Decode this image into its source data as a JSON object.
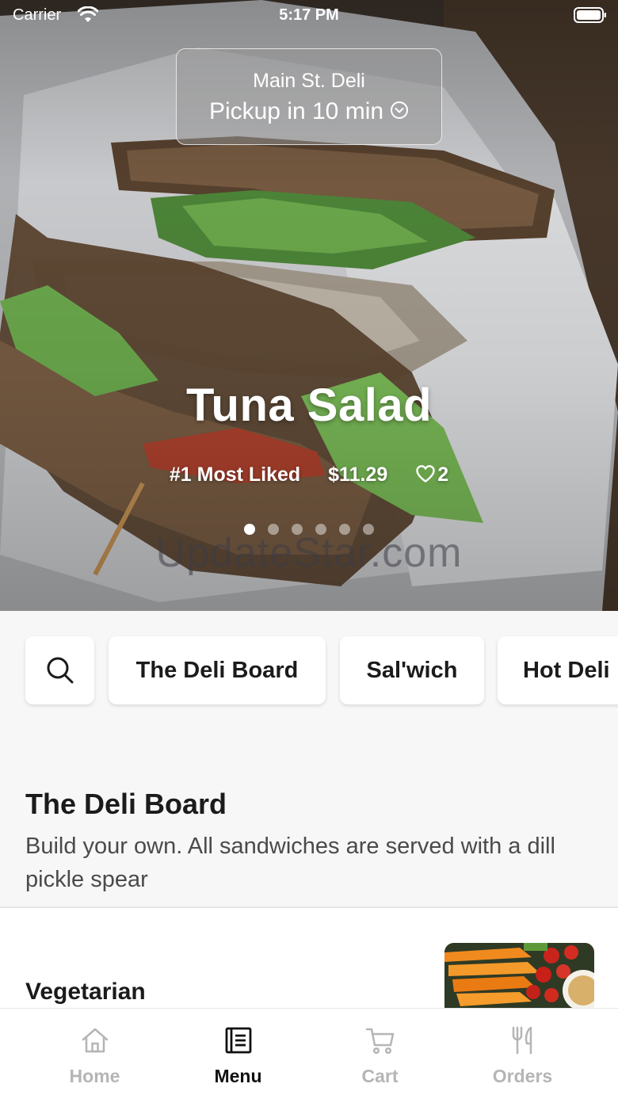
{
  "status_bar": {
    "carrier": "Carrier",
    "time": "5:17 PM"
  },
  "pickup": {
    "store": "Main St. Deli",
    "time": "Pickup in 10 min"
  },
  "featured": {
    "title": "Tuna Salad",
    "rank": "#1 Most Liked",
    "price": "$11.29",
    "likes": "2",
    "slide_count": 6,
    "active_slide": 1
  },
  "watermark": "UpdateStar.com",
  "categories": {
    "search_icon": "search-icon",
    "items": [
      "The Deli Board",
      "Sal'wich",
      "Hot Deli"
    ]
  },
  "section": {
    "title": "The Deli Board",
    "description": "Build your own. All sandwiches are served with a dill pickle spear"
  },
  "menu_item": {
    "name": "Vegetarian"
  },
  "tabs": [
    {
      "label": "Home",
      "icon": "home-icon",
      "active": false
    },
    {
      "label": "Menu",
      "icon": "menu-icon",
      "active": true
    },
    {
      "label": "Cart",
      "icon": "cart-icon",
      "active": false
    },
    {
      "label": "Orders",
      "icon": "orders-icon",
      "active": false
    }
  ],
  "colors": {
    "active_tab": "#111111",
    "inactive_tab": "#b5b5b5",
    "background": "#f7f7f7"
  }
}
